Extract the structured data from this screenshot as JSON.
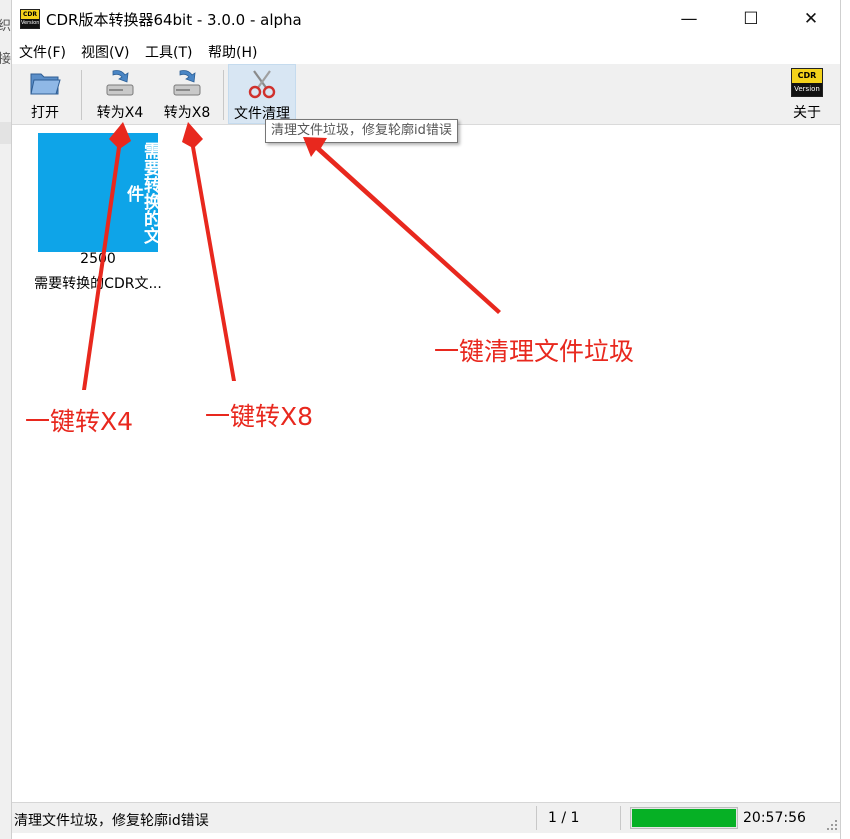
{
  "window": {
    "title": "CDR版本转换器64bit - 3.0.0 - alpha",
    "logo_top": "CDR",
    "logo_bottom": "Version",
    "controls": {
      "minimize": "—",
      "maximize": "☐",
      "close": "✕"
    }
  },
  "background": {
    "glyph1": "织",
    "glyph2": "接"
  },
  "menu": [
    {
      "label": "文件(F)"
    },
    {
      "label": "视图(V)"
    },
    {
      "label": "工具(T)"
    },
    {
      "label": "帮助(H)"
    }
  ],
  "toolbar": {
    "open_label": "打开",
    "to_x4_label": "转为X4",
    "to_x8_label": "转为X8",
    "clean_label": "文件清理",
    "about_label": "关于"
  },
  "tooltip": "清理文件垃圾，修复轮廓id错误",
  "file": {
    "thumb_text": "需要转换的文件",
    "size": "2500",
    "name": "需要转换的CDR文..."
  },
  "annotations": {
    "x4": "一键转X4",
    "x8": "一键转X8",
    "clean": "一键清理文件垃圾"
  },
  "status": {
    "text": "清理文件垃圾，修复轮廓id错误",
    "page": "1 / 1",
    "progress": 1.0,
    "time": "20:57:56"
  },
  "colors": {
    "accent_red": "#e8281e",
    "progress_green": "#06b025",
    "thumb_blue": "#0ea4e8",
    "logo_yellow": "#f3d21a"
  },
  "icons": {
    "open": "folder-open-icon",
    "convert": "drive-download-icon",
    "clean": "scissors-icon",
    "about": "cdr-version-logo"
  }
}
